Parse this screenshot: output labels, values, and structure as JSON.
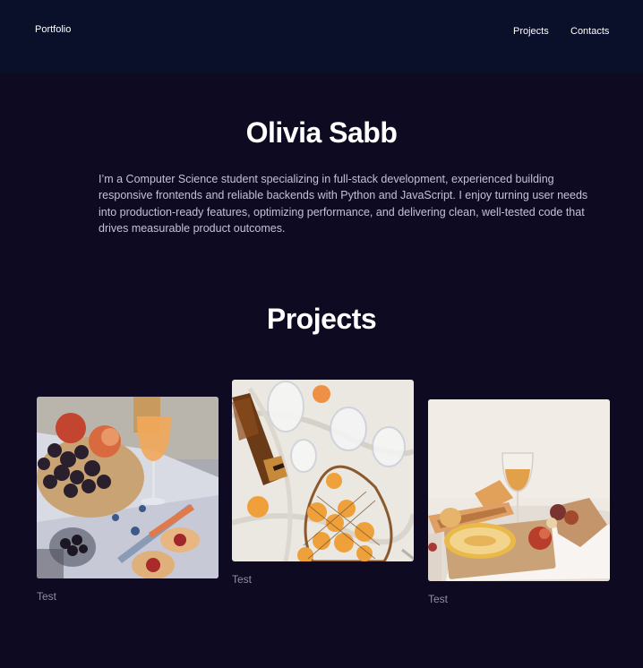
{
  "header": {
    "brand": "Portfolio",
    "nav": [
      {
        "label": "Projects"
      },
      {
        "label": "Contacts"
      }
    ]
  },
  "hero": {
    "name": "Olivia Sabb",
    "bio": "I’m a Computer Science student specializing in full-stack development,  experienced building responsive frontends and reliable backends with  Python and JavaScript. I enjoy turning user needs into production-ready  features, optimizing performance, and delivering clean, well-tested code that drives measurable product outcomes."
  },
  "projects": {
    "title": "Projects",
    "items": [
      {
        "label": "Test",
        "image": "peaches-grapes-wine-photo"
      },
      {
        "label": "Test",
        "image": "bottle-apricots-net-bag-photo"
      },
      {
        "label": "Test",
        "image": "melon-wine-bread-photo"
      }
    ]
  },
  "colors": {
    "page_bg": "#0d0a22",
    "header_bg": "#0a0f2a",
    "body_text": "#c4c2d6",
    "muted_text": "#8f8da3"
  }
}
